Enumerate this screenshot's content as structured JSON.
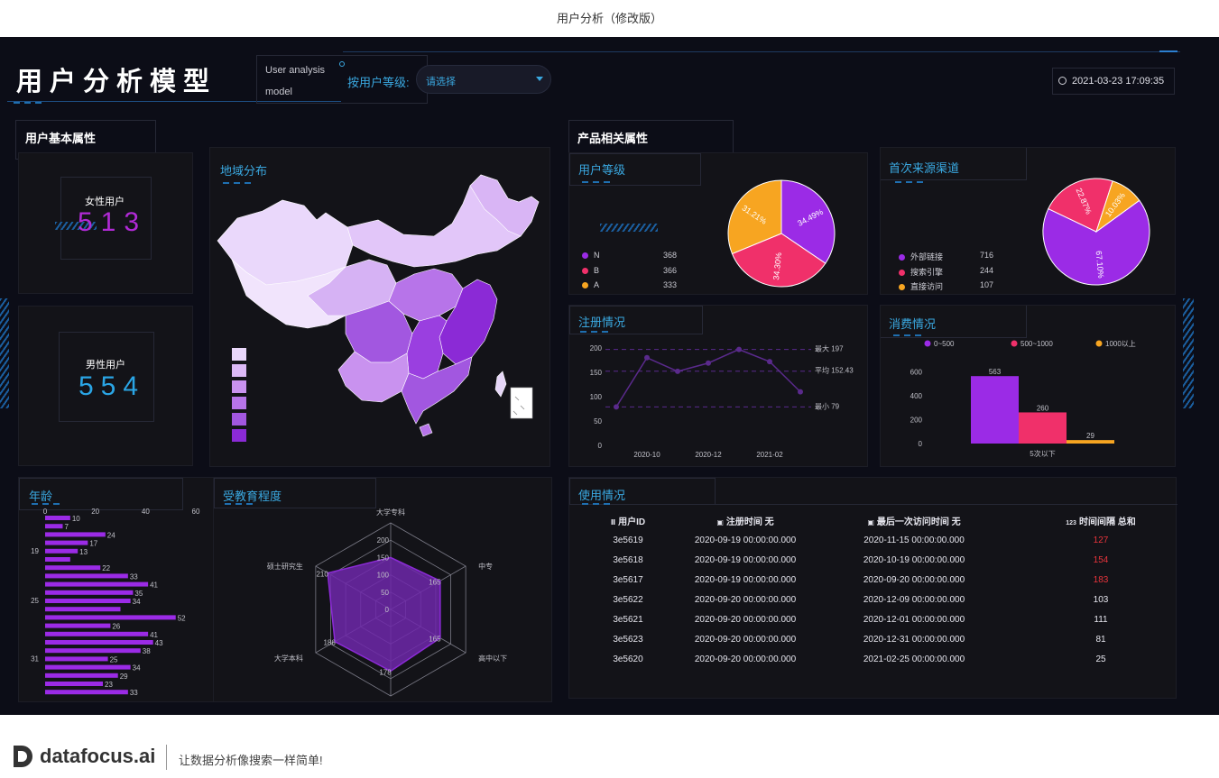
{
  "page_title": "用户分析（修改版）",
  "header": {
    "title": "用户分析模型",
    "subtitle_line1": "User analysis",
    "subtitle_line2": "model",
    "filter_label": "按用户等级:",
    "filter_value": "请选择",
    "datetime": "2021-03-23 17:09:35"
  },
  "sections": {
    "user_basic": "用户基本属性",
    "product": "产品相关属性"
  },
  "female": {
    "label": "女性用户",
    "value": "513"
  },
  "male": {
    "label": "男性用户",
    "value": "554"
  },
  "map": {
    "title": "地域分布",
    "legend_colors": [
      "#ead8fb",
      "#dcb9f6",
      "#c992ef",
      "#b774e9",
      "#a257e0",
      "#8b2ad6"
    ]
  },
  "user_level": {
    "title": "用户等级",
    "legend": [
      {
        "name": "N",
        "value": "368",
        "color": "#9b2be6"
      },
      {
        "name": "B",
        "value": "366",
        "color": "#f0306a"
      },
      {
        "name": "A",
        "value": "333",
        "color": "#f7a521"
      }
    ],
    "chart_data": {
      "type": "pie",
      "slices": [
        {
          "name": "N",
          "value": 368,
          "pct": "34.49%",
          "color": "#9b2be6"
        },
        {
          "name": "B",
          "value": 366,
          "pct": "34.30%",
          "color": "#f0306a"
        },
        {
          "name": "A",
          "value": 333,
          "pct": "31.21%",
          "color": "#f7a521"
        }
      ]
    }
  },
  "first_source": {
    "title": "首次来源渠道",
    "legend": [
      {
        "name": "外部链接",
        "value": "716",
        "color": "#9b2be6"
      },
      {
        "name": "搜索引擎",
        "value": "244",
        "color": "#f0306a"
      },
      {
        "name": "直接访问",
        "value": "107",
        "color": "#f7a521"
      }
    ],
    "chart_data": {
      "type": "pie",
      "slices": [
        {
          "name": "外部链接",
          "value": 716,
          "pct": "67.10%",
          "color": "#9b2be6"
        },
        {
          "name": "搜索引擎",
          "value": 244,
          "pct": "22.87%",
          "color": "#f0306a"
        },
        {
          "name": "直接访问",
          "value": 107,
          "pct": "10.03%",
          "color": "#f7a521"
        }
      ]
    }
  },
  "registration": {
    "title": "注册情况",
    "chart_data": {
      "type": "line",
      "values": [
        79,
        180,
        152,
        169,
        197,
        172,
        110
      ],
      "x_ticks": [
        {
          "label": "2020-10",
          "index": 1
        },
        {
          "label": "2020-12",
          "index": 3
        },
        {
          "label": "2021-02",
          "index": 5
        }
      ],
      "y_ticks": [
        "0",
        "50",
        "100",
        "150",
        "200"
      ],
      "ylim": [
        0,
        200
      ],
      "ref_lines": [
        {
          "label": "最大 197",
          "value": 197
        },
        {
          "label": "平均 152.43",
          "value": 152.43
        },
        {
          "label": "最小 79",
          "value": 79
        }
      ],
      "color": "#5a2a8c"
    }
  },
  "consumption": {
    "title": "消费情况",
    "chart_data": {
      "type": "bar",
      "categories": [
        "5次以下"
      ],
      "series": [
        {
          "name": "0~500",
          "values": [
            563
          ],
          "color": "#9b2be6"
        },
        {
          "name": "500~1000",
          "values": [
            260
          ],
          "color": "#f0306a"
        },
        {
          "name": "1000以上",
          "values": [
            29
          ],
          "color": "#f7a521"
        }
      ],
      "y_ticks": [
        "0",
        "200",
        "400",
        "600"
      ],
      "ylim": [
        0,
        700
      ]
    }
  },
  "age": {
    "title": "年龄",
    "chart_data": {
      "type": "bar",
      "orientation": "horizontal",
      "values": [
        10,
        7,
        24,
        17,
        13,
        10,
        22,
        33,
        41,
        35,
        34,
        30,
        52,
        26,
        41,
        43,
        38,
        25,
        34,
        29,
        23,
        33
      ],
      "labels": [
        "10",
        "7",
        "24",
        "17",
        "13",
        "",
        "22",
        "33",
        "41",
        "35",
        "34",
        "",
        "52",
        "26",
        "41",
        "43",
        "38",
        "25",
        "34",
        "29",
        "23",
        "33"
      ],
      "y_ticks": [
        {
          "label": "19",
          "index": 4
        },
        {
          "label": "25",
          "index": 10
        },
        {
          "label": "31",
          "index": 17
        },
        {
          "label": "37",
          "index": 23
        }
      ],
      "x_ticks": [
        "0",
        "20",
        "40",
        "60"
      ],
      "xlim": [
        0,
        60
      ],
      "color": "#9b2be6"
    }
  },
  "education": {
    "title": "受教育程度",
    "chart_data": {
      "type": "radar",
      "axes": [
        {
          "name": "大学专科",
          "value": 150
        },
        {
          "name": "中专",
          "value": 165
        },
        {
          "name": "高中以下",
          "value": 165
        },
        {
          "name": "博士研究生",
          "value": 178
        },
        {
          "name": "大学本科",
          "value": 186
        },
        {
          "name": "硕士研究生",
          "value": 210
        }
      ],
      "value_labels": [
        "",
        "165",
        "165",
        "178",
        "186",
        "210"
      ],
      "scale_labels": [
        "0",
        "50",
        "100",
        "150",
        "200"
      ],
      "max": 250
    }
  },
  "usage": {
    "title": "使用情况",
    "columns": [
      "用户ID",
      "注册时间 无",
      "最后一次访问时间 无",
      "时间间隔 总和"
    ],
    "column_icons": [
      "Ⅱ",
      "▣",
      "▣",
      "123"
    ],
    "rows": [
      {
        "id": "3e5619",
        "reg": "2020-09-19 00:00:00.000",
        "last": "2020-11-15 00:00:00.000",
        "gap": "127",
        "alert": true
      },
      {
        "id": "3e5618",
        "reg": "2020-09-19 00:00:00.000",
        "last": "2020-10-19 00:00:00.000",
        "gap": "154",
        "alert": true
      },
      {
        "id": "3e5617",
        "reg": "2020-09-19 00:00:00.000",
        "last": "2020-09-20 00:00:00.000",
        "gap": "183",
        "alert": true
      },
      {
        "id": "3e5622",
        "reg": "2020-09-20 00:00:00.000",
        "last": "2020-12-09 00:00:00.000",
        "gap": "103",
        "alert": false
      },
      {
        "id": "3e5621",
        "reg": "2020-09-20 00:00:00.000",
        "last": "2020-12-01 00:00:00.000",
        "gap": "111",
        "alert": false
      },
      {
        "id": "3e5623",
        "reg": "2020-09-20 00:00:00.000",
        "last": "2020-12-31 00:00:00.000",
        "gap": "81",
        "alert": false
      },
      {
        "id": "3e5620",
        "reg": "2020-09-20 00:00:00.000",
        "last": "2021-02-25 00:00:00.000",
        "gap": "25",
        "alert": false
      }
    ]
  },
  "footer": {
    "brand": "datafocus.ai",
    "slogan": "让数据分析像搜索一样简单!"
  }
}
